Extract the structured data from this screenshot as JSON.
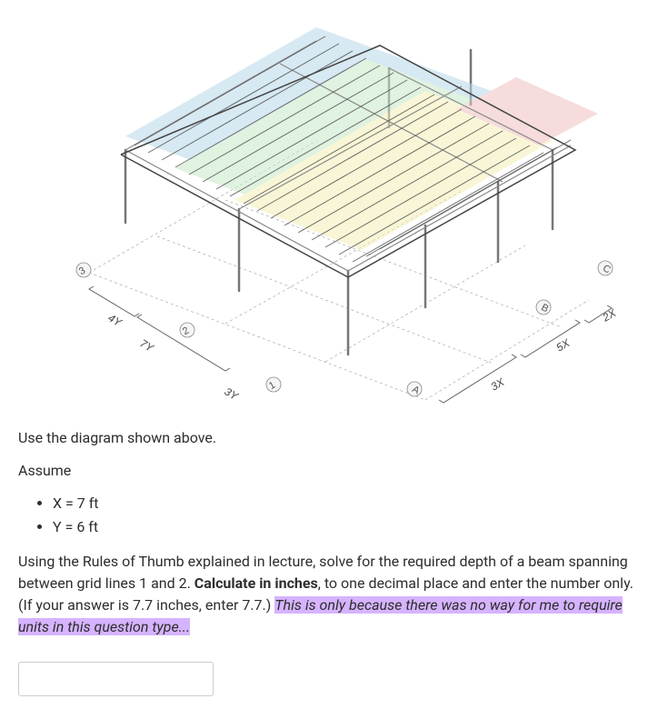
{
  "diagram": {
    "grid_labels": {
      "numbers": [
        "1",
        "2",
        "3"
      ],
      "letters": [
        "A",
        "B",
        "C"
      ]
    },
    "dimensions": {
      "left_near": "4Y",
      "left_far": "7Y",
      "left_bottom": "3Y",
      "right_near": "3X",
      "right_mid": "5X",
      "right_far": "2X"
    }
  },
  "text": {
    "intro": "Use the diagram shown above.",
    "assume_label": "Assume",
    "assumptions": [
      "X = 7 ft",
      "Y = 6 ft"
    ],
    "question_p1": "Using the Rules of Thumb explained in lecture, solve for the required depth of a beam spanning between grid lines 1 and 2. ",
    "question_bold": "Calculate in inches",
    "question_p2": ", to one decimal place and enter the number only. (If your answer is 7.7 inches, enter 7.7.) ",
    "question_highlight": "This is only because there was no way for me to require units in this question type..."
  },
  "input": {
    "value": "",
    "placeholder": ""
  }
}
